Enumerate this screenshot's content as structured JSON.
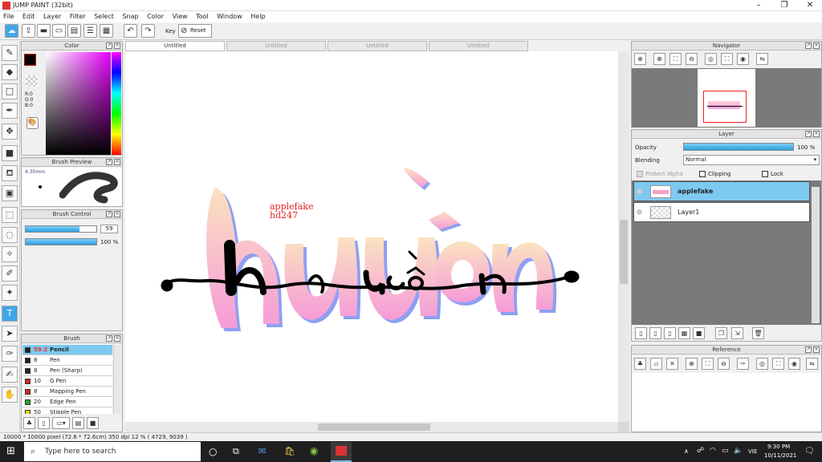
{
  "window": {
    "title": "JUMP PAINT (32bit)"
  },
  "menu": [
    "File",
    "Edit",
    "Layer",
    "Filter",
    "Select",
    "Snap",
    "Color",
    "View",
    "Tool",
    "Window",
    "Help"
  ],
  "toolbar": {
    "key_label": "Key",
    "reset_label": "Reset"
  },
  "tabs": [
    {
      "label": "Untitled"
    },
    {
      "label": "Untitled"
    },
    {
      "label": "Untitled"
    },
    {
      "label": "Untitled"
    }
  ],
  "color_panel": {
    "title": "Color",
    "r": "R:0",
    "g": "G:0",
    "b": "B:0",
    "fg": "#000000",
    "bg": "#ffffff"
  },
  "brush_preview": {
    "title": "Brush Preview",
    "size": "4.30mm"
  },
  "brush_control": {
    "title": "Brush Control",
    "size_value": "59",
    "opacity_value": "100 %",
    "size_fraction": 0.76,
    "opacity_fraction": 1.0
  },
  "brush": {
    "title": "Brush",
    "items": [
      {
        "size": "59.2",
        "name": "Pencil",
        "color": "#222222"
      },
      {
        "size": "8",
        "name": "Pen",
        "color": "#222222"
      },
      {
        "size": "8",
        "name": "Pen (Sharp)",
        "color": "#222222"
      },
      {
        "size": "10",
        "name": "G Pen",
        "color": "#dd2222"
      },
      {
        "size": "8",
        "name": "Mapping Pen",
        "color": "#dd2222"
      },
      {
        "size": "20",
        "name": "Edge Pen",
        "color": "#22aa22"
      },
      {
        "size": "50",
        "name": "Stipple Pen",
        "color": "#dddd22"
      }
    ]
  },
  "navigator": {
    "title": "Navigator"
  },
  "layer": {
    "title": "Layer",
    "opacity_label": "Opacity",
    "opacity_value": "100 %",
    "opacity_fraction": 1.0,
    "blending_label": "Blending",
    "blending_value": "Normal",
    "protect_alpha": "Protect Alpha",
    "clipping": "Clipping",
    "lock": "Lock",
    "items": [
      {
        "name": "applefake",
        "selected": true
      },
      {
        "name": "Layer1",
        "selected": false
      }
    ]
  },
  "reference": {
    "title": "Reference"
  },
  "artwork": {
    "caption_line1": "applefake",
    "caption_line2": "hd247"
  },
  "status": {
    "text": "10000 * 10000 pixel   (72.6 * 72.6cm)   350 dpi   12 %   ( 4729, 9039 )"
  },
  "taskbar": {
    "search_placeholder": "Type here to search",
    "lang": "VIE",
    "time": "9:30 PM",
    "date": "10/11/2021"
  }
}
